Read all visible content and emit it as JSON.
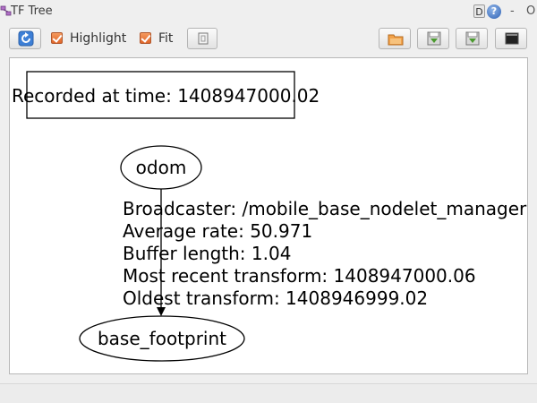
{
  "window": {
    "title": "TF Tree",
    "help_letter": "D",
    "help_icon_label": "?",
    "close_label": "-",
    "restore_label": "O"
  },
  "toolbar": {
    "highlight_label": "Highlight",
    "fit_label": "Fit",
    "highlight_checked": true,
    "fit_checked": true,
    "icons": [
      "refresh-icon",
      "square-icon",
      "open-folder-icon",
      "save-icon",
      "save-as-icon",
      "screenshot-icon"
    ]
  },
  "graph": {
    "recorded_label": "Recorded at time: 1408947000.02",
    "nodes": {
      "parent": "odom",
      "child": "base_footprint"
    },
    "edge_info": {
      "broadcaster": "Broadcaster: /mobile_base_nodelet_manager",
      "average_rate": "Average rate: 50.971",
      "buffer_length": "Buffer length: 1.04",
      "most_recent": "Most recent transform: 1408947000.06",
      "oldest": "Oldest transform: 1408946999.02"
    }
  },
  "colors": {
    "checkbox": "#e8763a",
    "help": "#2f62b4"
  }
}
